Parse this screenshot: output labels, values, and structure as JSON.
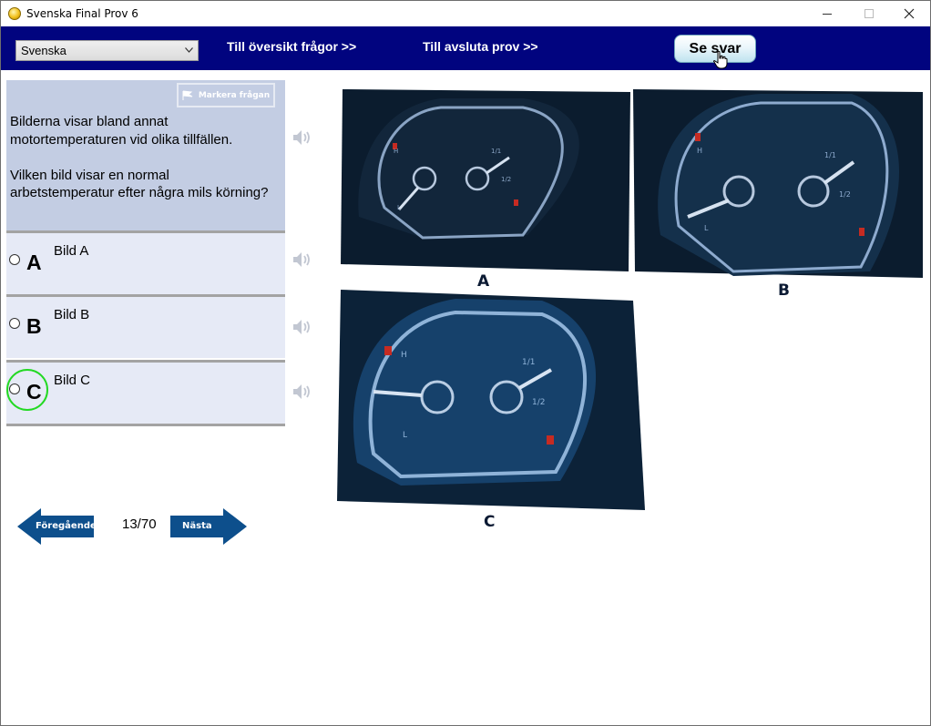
{
  "window": {
    "title": "Svenska Final Prov 6",
    "icon": "app-coin-icon"
  },
  "navbar": {
    "language": "Svenska",
    "overview_link": "Till översikt frågor >>",
    "finish_link": "Till avsluta prov  >>",
    "show_answer": "Se svar",
    "background": "#01047f"
  },
  "question": {
    "flag_label": "Markera frågan",
    "text": "Bilderna visar bland annat motortemperaturen vid olika tillfällen.\n\nVilken bild visar en normal arbetstemperatur efter några mils körning?"
  },
  "options": [
    {
      "letter": "A",
      "text": "Bild A",
      "selected": false
    },
    {
      "letter": "B",
      "text": "Bild B",
      "selected": false
    },
    {
      "letter": "C",
      "text": "Bild C",
      "selected": false,
      "highlighted": true
    }
  ],
  "pagination": {
    "previous": "Föregående",
    "next": "Nästa",
    "counter": "13/70"
  },
  "images": [
    {
      "label": "A",
      "temp_needle": "low"
    },
    {
      "label": "B",
      "temp_needle": "low"
    },
    {
      "label": "C",
      "temp_needle": "middle"
    }
  ],
  "gauge_text": {
    "hot": "H",
    "cold": "L",
    "full": "1/1",
    "half": "1/2"
  },
  "colors": {
    "question_bg": "#c3cde3",
    "option_bg": "#e6eaf6",
    "arrow_blue": "#0d4f8c",
    "highlight_green": "#23d923"
  }
}
